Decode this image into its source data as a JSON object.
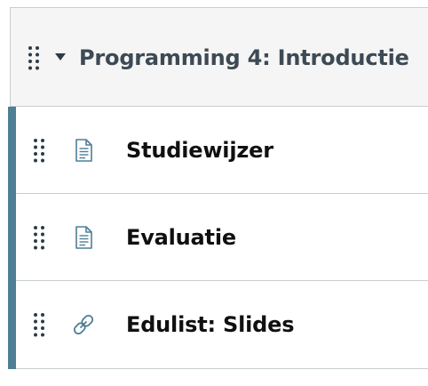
{
  "module": {
    "title": "Programming 4: Introductie",
    "expanded": true,
    "accent_color": "#4e7f94",
    "toggle_icon": "caret-down-icon",
    "drag_icon": "drag-handle-icon"
  },
  "items": [
    {
      "label": "Studiewijzer",
      "icon": "document-icon"
    },
    {
      "label": "Evaluatie",
      "icon": "document-icon"
    },
    {
      "label": "Edulist: Slides",
      "icon": "link-icon"
    }
  ]
}
